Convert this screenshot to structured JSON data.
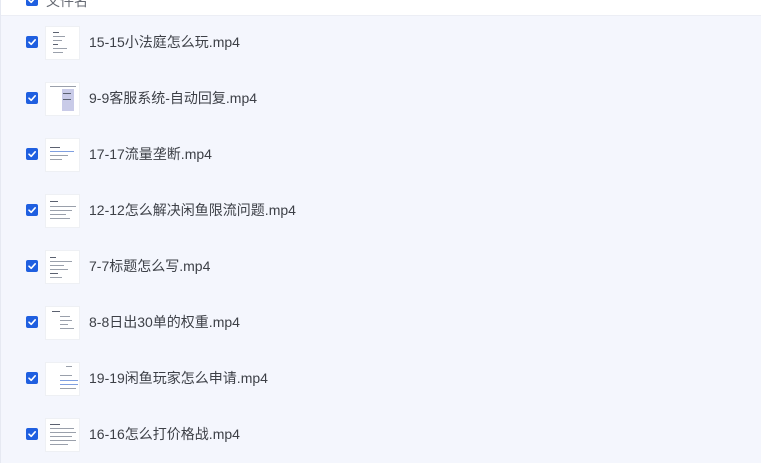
{
  "list": {
    "header_label": "文件名",
    "items": [
      {
        "filename": "15-15小法庭怎么玩.mp4",
        "checked": true
      },
      {
        "filename": "9-9客服系统-自动回复.mp4",
        "checked": true
      },
      {
        "filename": "17-17流量垄断.mp4",
        "checked": true
      },
      {
        "filename": "12-12怎么解决闲鱼限流问题.mp4",
        "checked": true
      },
      {
        "filename": "7-7标题怎么写.mp4",
        "checked": true
      },
      {
        "filename": "8-8日出30单的权重.mp4",
        "checked": true
      },
      {
        "filename": "19-19闲鱼玩家怎么申请.mp4",
        "checked": true
      },
      {
        "filename": "16-16怎么打价格战.mp4",
        "checked": true
      }
    ]
  },
  "colors": {
    "checkbox": "#1f5fe0",
    "panel_background": "#f4f6fd",
    "filename_text": "#3d4047"
  }
}
